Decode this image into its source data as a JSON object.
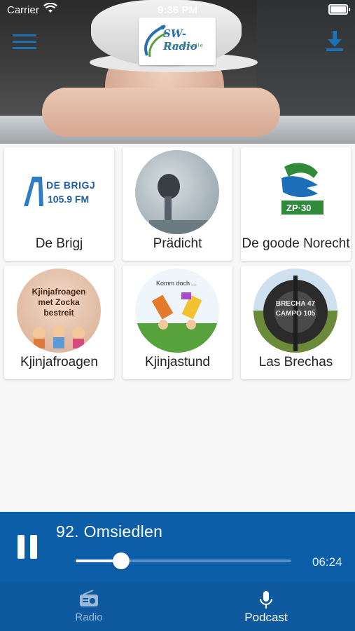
{
  "status_bar": {
    "carrier": "Carrier",
    "time": "9:36 PM"
  },
  "header": {
    "logo_text": "SW-Radio",
    "logo_subtext": "Segenswelle",
    "menu_icon": "hamburger-menu-icon",
    "download_icon": "download-icon"
  },
  "podcasts": [
    {
      "label": "De Brigj",
      "art_text": "DE BRIGJ",
      "art_subtext": "105.9 FM"
    },
    {
      "label": "Prädicht"
    },
    {
      "label": "De goode Norecht",
      "art_text": "ZP·30"
    },
    {
      "label": "Kjinjafroagen",
      "art_text": "Kjinjafroagen met Zocka bestreit"
    },
    {
      "label": "Kjinjastund",
      "art_text": "Komm doch ..."
    },
    {
      "label": "Las Brechas",
      "art_text": "BRECHA 47 CAMPO 105"
    }
  ],
  "player": {
    "track_title": "92. Omsiedlen",
    "duration": "06:24",
    "progress": 0.21,
    "pause_icon": "pause-icon"
  },
  "tabs": [
    {
      "label": "Radio",
      "icon": "radio-icon",
      "active": false
    },
    {
      "label": "Podcast",
      "icon": "microphone-icon",
      "active": true
    }
  ],
  "colors": {
    "accent": "#0d5ea8",
    "tab_inactive": "#9bb8d6",
    "icon_blue": "#1a73b5"
  }
}
